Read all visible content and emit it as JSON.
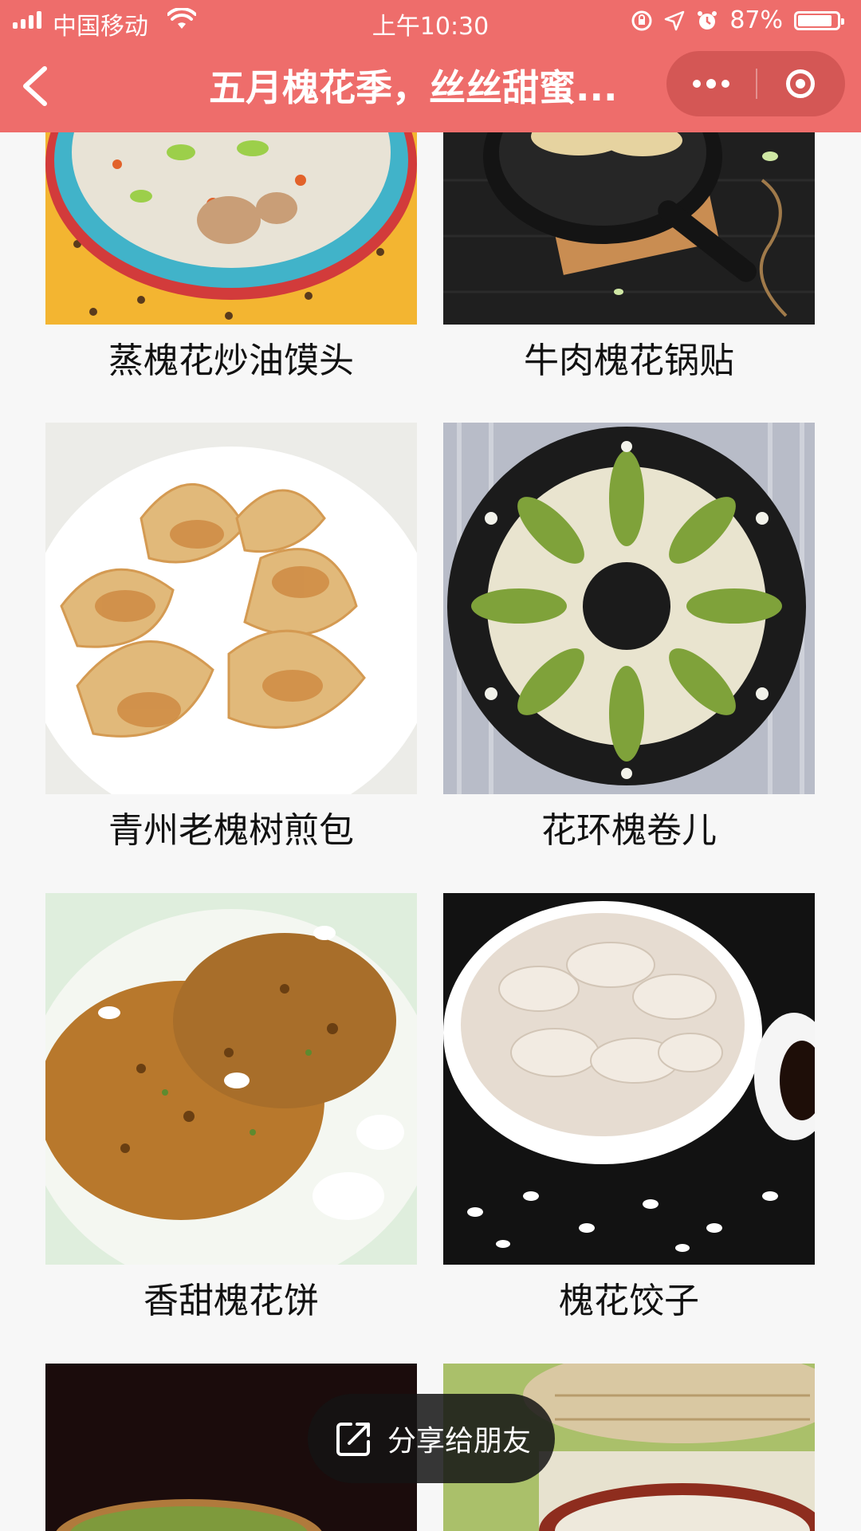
{
  "status_bar": {
    "carrier": "中国移动",
    "time": "上午10:30",
    "battery_text": "87%",
    "battery_level": 0.87
  },
  "nav": {
    "title": "五月槐花季，丝丝甜蜜..."
  },
  "recipes": [
    {
      "name": "蒸槐花炒油馍头",
      "image": "槐花 salad bowl"
    },
    {
      "name": "牛肉槐花锅贴",
      "image": "pan-fried potstickers"
    },
    {
      "name": "青州老槐树煎包",
      "image": "pan-fried buns on plate"
    },
    {
      "name": "花环槐卷儿",
      "image": "wreath bun with green braids"
    },
    {
      "name": "香甜槐花饼",
      "image": "golden pancakes with flowers"
    },
    {
      "name": "槐花饺子",
      "image": "boiled dumplings in bowl"
    },
    {
      "name": "",
      "image": "dark kitchen photo"
    },
    {
      "name": "",
      "image": "槐花 dish in basket"
    }
  ],
  "share_button": {
    "label": "分享给朋友"
  },
  "colors": {
    "accent": "#ee6d6b",
    "background": "#f7f7f7"
  }
}
